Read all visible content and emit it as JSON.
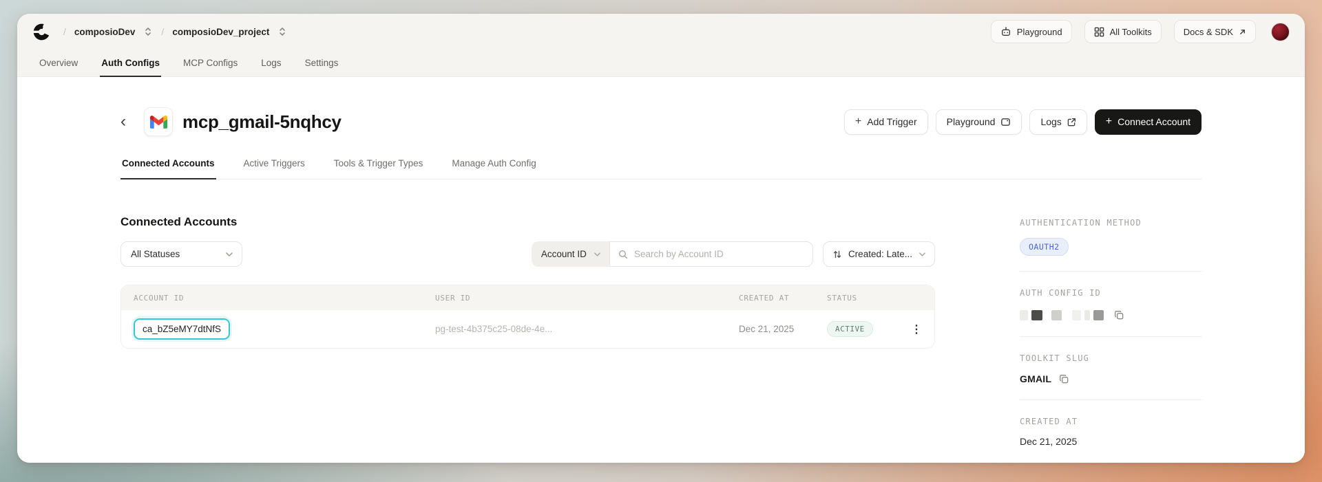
{
  "topbar": {
    "breadcrumb": {
      "separator": "/",
      "org": "composioDev",
      "project": "composioDev_project"
    },
    "buttons": {
      "playground": "Playground",
      "all_toolkits": "All Toolkits",
      "docs_sdk": "Docs & SDK"
    }
  },
  "nav_tabs": [
    {
      "label": "Overview",
      "active": false
    },
    {
      "label": "Auth Configs",
      "active": true
    },
    {
      "label": "MCP Configs",
      "active": false
    },
    {
      "label": "Logs",
      "active": false
    },
    {
      "label": "Settings",
      "active": false
    }
  ],
  "page": {
    "title": "mcp_gmail-5nqhcy",
    "back_glyph": "‹",
    "actions": {
      "plus": "+",
      "add_trigger": "Add Trigger",
      "playground": "Playground",
      "logs": "Logs",
      "connect_account": "Connect Account"
    },
    "tabs": [
      {
        "label": "Connected Accounts",
        "active": true
      },
      {
        "label": "Active Triggers",
        "active": false
      },
      {
        "label": "Tools & Trigger Types",
        "active": false
      },
      {
        "label": "Manage Auth Config",
        "active": false
      }
    ]
  },
  "accounts": {
    "heading": "Connected Accounts",
    "filters": {
      "status": "All Statuses",
      "search_field": "Account ID",
      "search_placeholder": "Search by Account ID",
      "sort": "Created: Late..."
    },
    "table": {
      "headers": [
        "ACCOUNT ID",
        "USER ID",
        "CREATED AT",
        "STATUS"
      ],
      "rows": [
        {
          "account_id": "ca_bZ5eMY7dtNfS",
          "user_id": "pg-test-4b375c25-08de-4e...",
          "created_at": "Dec 21, 2025",
          "status": "ACTIVE",
          "menu_glyph": "⋮"
        }
      ]
    }
  },
  "sidebar": {
    "auth_method": {
      "label": "AUTHENTICATION METHOD",
      "value": "OAUTH2"
    },
    "auth_config_id": {
      "label": "AUTH CONFIG ID",
      "value_redacted": true
    },
    "toolkit_slug": {
      "label": "TOOLKIT SLUG",
      "value": "GMAIL"
    },
    "created_at": {
      "label": "CREATED AT",
      "value": "Dec 21, 2025"
    }
  },
  "colors": {
    "highlight_cyan": "#35c6d8",
    "status_active_bg": "#eef7f1",
    "status_active_text": "#5f7a6e",
    "oauth_badge_bg": "#e9eefb",
    "oauth_badge_text": "#4a66c9",
    "connect_button_bg": "#181817",
    "header_band_bg": "#f5f4f1"
  }
}
